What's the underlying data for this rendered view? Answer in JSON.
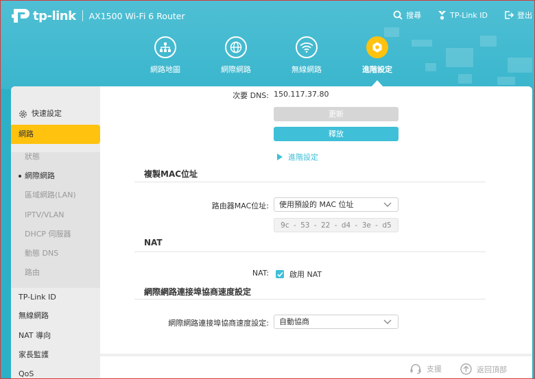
{
  "header": {
    "logo_text": "tp-link",
    "model": "AX1500 Wi-Fi 6 Router",
    "actions": [
      {
        "label": "搜尋",
        "icon": "search-icon"
      },
      {
        "label": "TP-Link ID",
        "icon": "user-id-icon"
      },
      {
        "label": "登出",
        "icon": "logout-icon"
      }
    ]
  },
  "nav": [
    {
      "label": "網路地圖",
      "icon": "network-map-icon",
      "active": false
    },
    {
      "label": "網際網路",
      "icon": "globe-icon",
      "active": false
    },
    {
      "label": "無線網路",
      "icon": "wifi-icon",
      "active": false
    },
    {
      "label": "進階設定",
      "icon": "gear-icon",
      "active": true
    }
  ],
  "sidebar": {
    "quick_setup": "快速設定",
    "network": "網路",
    "sub_items": [
      "狀態",
      "網際網路",
      "區域網路(LAN)",
      "IPTV/VLAN",
      "DHCP 伺服器",
      "動態 DNS",
      "路由"
    ],
    "active_sub": "網際網路",
    "items": [
      "TP-Link ID",
      "無線網路",
      "NAT 導向",
      "家長監護",
      "QoS"
    ]
  },
  "main": {
    "secondary_dns_label": "次要 DNS:",
    "secondary_dns_value": "150.117.37.80",
    "renew_button": "更新",
    "release_button": "釋放",
    "advanced_link": "進階設定",
    "clone_mac_title": "複製MAC位址",
    "router_mac_label": "路由器MAC位址:",
    "router_mac_select": "使用預設的 MAC 位址",
    "mac_parts": [
      "9c",
      "-",
      "53",
      "-",
      "22",
      "-",
      "d4",
      "-",
      "3e",
      "-",
      "d5"
    ],
    "nat_title": "NAT",
    "nat_label": "NAT:",
    "nat_checkbox_label": "啟用 NAT",
    "speed_title": "網際網路連接埠協商速度設定",
    "speed_label": "網際網路連接埠協商速度設定:",
    "speed_select": "自動協商"
  },
  "footer": {
    "support": "支援",
    "back_to_top": "返回頂部"
  },
  "colors": {
    "accent": "#3fbfd8",
    "active_yellow": "#ffc20e",
    "header_teal": "#3ab6cd"
  }
}
